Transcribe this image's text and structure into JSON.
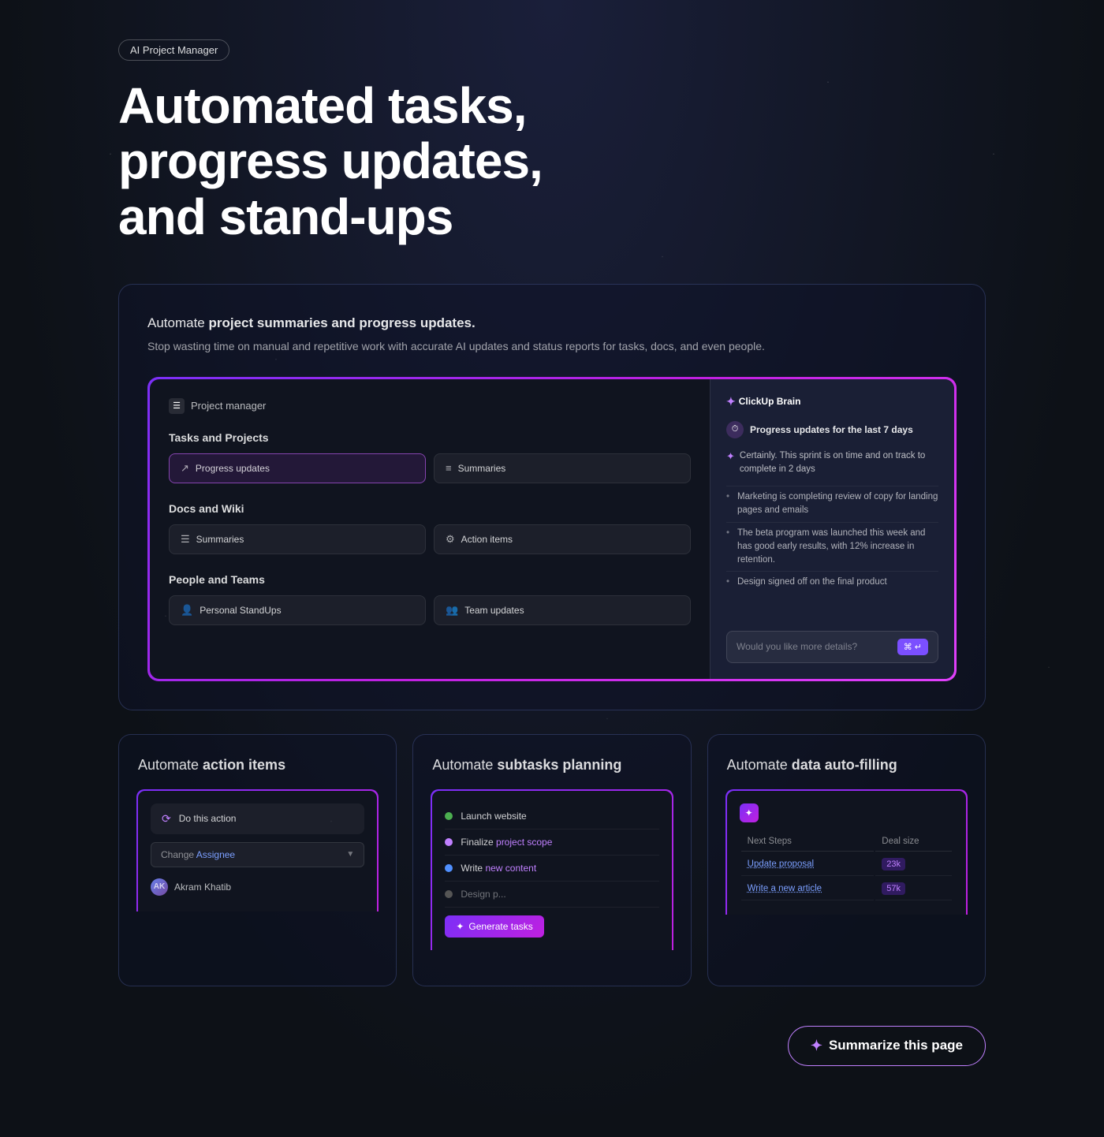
{
  "badge": {
    "label": "AI Project Manager"
  },
  "hero": {
    "title": "Automated tasks, progress updates, and stand-ups"
  },
  "main_card": {
    "text_normal": "Automate ",
    "text_bold": "project summaries and progress updates.",
    "subtitle": "Stop wasting time on manual and repetitive work with accurate AI updates and status reports for tasks, docs, and even people.",
    "demo": {
      "header_icon": "☰",
      "header_title": "Project manager",
      "sections": [
        {
          "title": "Tasks and Projects",
          "items": [
            {
              "icon": "↗",
              "label": "Progress updates",
              "highlighted": true
            },
            {
              "icon": "≡",
              "label": "Summaries",
              "highlighted": false
            }
          ]
        },
        {
          "title": "Docs and Wiki",
          "items": [
            {
              "icon": "☰",
              "label": "Summaries",
              "highlighted": false
            },
            {
              "icon": "⚙",
              "label": "Action items",
              "highlighted": false
            }
          ]
        },
        {
          "title": "People and Teams",
          "items": [
            {
              "icon": "👤",
              "label": "Personal StandUps",
              "highlighted": false
            },
            {
              "icon": "👥",
              "label": "Team updates",
              "highlighted": false
            }
          ]
        }
      ],
      "brain_panel": {
        "logo": "ClickUp Brain",
        "query": "Progress updates for the last 7 days",
        "response_intro": "Certainly. This sprint is on time and on track to complete in 2 days",
        "bullets": [
          "Marketing is completing review of copy for landing pages and emails",
          "The beta program was launched this week and has good early results, with 12% increase in retention.",
          "Design signed off on the final product"
        ],
        "input_placeholder": "Would you like more details?",
        "input_btn": "⌘ ↵"
      }
    }
  },
  "bottom_cards": [
    {
      "title_normal": "Automate ",
      "title_bold": "action items",
      "demo": {
        "action_item": "Do this action",
        "select_label": "Change",
        "select_field": "Assignee",
        "select_value": "Akram Khatib",
        "chevron": "▼"
      }
    },
    {
      "title_normal": "Automate ",
      "title_bold": "subtasks planning",
      "demo": {
        "items": [
          {
            "color": "#4CAF50",
            "label": "Launch website",
            "strikethrough": false
          },
          {
            "color": "#c080ff",
            "label": "Finalize project scope",
            "strikethrough": false,
            "link": true
          },
          {
            "color": "#5090ff",
            "label": "Write new content",
            "strikethrough": false,
            "link": true
          },
          {
            "color": "#666",
            "label": "Design p...",
            "strikethrough": false
          }
        ],
        "generate_btn": "Generate tasks"
      }
    },
    {
      "title_normal": "Automate ",
      "title_bold": "data auto-filling",
      "demo": {
        "columns": [
          "Next Steps",
          "Deal size"
        ],
        "rows": [
          {
            "next_step": "Update proposal",
            "next_step_link": true,
            "deal_size": "23k"
          },
          {
            "next_step": "Write a new article",
            "next_step_link": true,
            "deal_size": "57k"
          }
        ]
      }
    }
  ],
  "summarize_btn": {
    "label": "Summarize this page",
    "icon": "✦"
  }
}
